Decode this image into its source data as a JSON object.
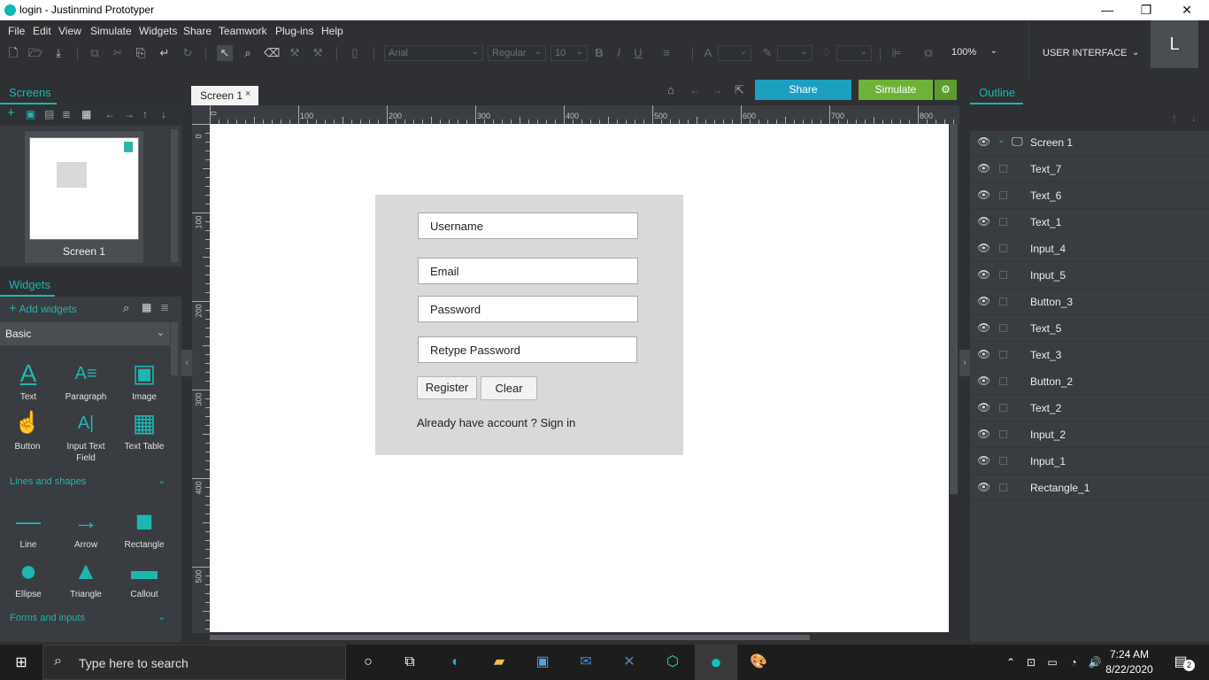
{
  "window": {
    "title": "login - Justinmind Prototyper",
    "minimize_glyph": "—",
    "maximize_glyph": "❐",
    "close_glyph": "✕"
  },
  "menu": [
    "File",
    "Edit",
    "View",
    "Simulate",
    "Widgets",
    "Share",
    "Teamwork",
    "Plug-ins",
    "Help"
  ],
  "toolbar": {
    "font": "Arial",
    "weight": "Regular",
    "size": "10",
    "bold": "B",
    "italic": "I",
    "underline": "U",
    "font_color_glyph": "A",
    "zoom": "100%",
    "mode": "USER INTERFACE"
  },
  "user": {
    "avatar_letter": "L"
  },
  "screens_panel": {
    "tab": "Screens",
    "screens": [
      {
        "name": "Screen 1"
      }
    ]
  },
  "widgets_panel": {
    "tab": "Widgets",
    "add_label": "Add widgets",
    "category": "Basic",
    "basic": [
      {
        "name": "Text",
        "glyph": "A"
      },
      {
        "name": "Paragraph",
        "glyph": "A≡"
      },
      {
        "name": "Image",
        "glyph": "▣"
      },
      {
        "name": "Button",
        "glyph": "☝"
      },
      {
        "name": "Input Text Field",
        "glyph": "A|"
      },
      {
        "name": "Text Table",
        "glyph": "▦"
      }
    ],
    "section_lines": "Lines and shapes",
    "lines": [
      {
        "name": "Line",
        "glyph": "—"
      },
      {
        "name": "Arrow",
        "glyph": "→"
      },
      {
        "name": "Rectangle",
        "glyph": "■"
      },
      {
        "name": "Ellipse",
        "glyph": "●"
      },
      {
        "name": "Triangle",
        "glyph": "▲"
      },
      {
        "name": "Callout",
        "glyph": "▬"
      }
    ],
    "section_forms": "Forms and inputs"
  },
  "editor": {
    "tab": "Screen 1",
    "share": "Share",
    "simulate": "Simulate",
    "ruler_top": [
      "0",
      "100",
      "200",
      "300",
      "400",
      "500",
      "600",
      "700",
      "800"
    ],
    "ruler_left": [
      "0",
      "100",
      "200",
      "300",
      "400",
      "500"
    ]
  },
  "prototype": {
    "username_placeholder": "Username",
    "email_placeholder": "Email",
    "password_placeholder": "Password",
    "retype_placeholder": "Retype Password",
    "register": "Register",
    "clear": "Clear",
    "signin_text": "Already have account ? Sign in"
  },
  "outline": {
    "tab": "Outline",
    "root": "Screen 1",
    "items": [
      "Text_7",
      "Text_6",
      "Text_1",
      "Input_4",
      "Input_5",
      "Button_3",
      "Text_5",
      "Text_3",
      "Button_2",
      "Text_2",
      "Input_2",
      "Input_1",
      "Rectangle_1"
    ]
  },
  "taskbar": {
    "search_placeholder": "Type here to search",
    "time": "7:24 AM",
    "date": "8/22/2020",
    "notifications": "2"
  },
  "colors": {
    "accent": "#1fb5b2",
    "share": "#1d9fc1",
    "simulate": "#6fb23a"
  }
}
